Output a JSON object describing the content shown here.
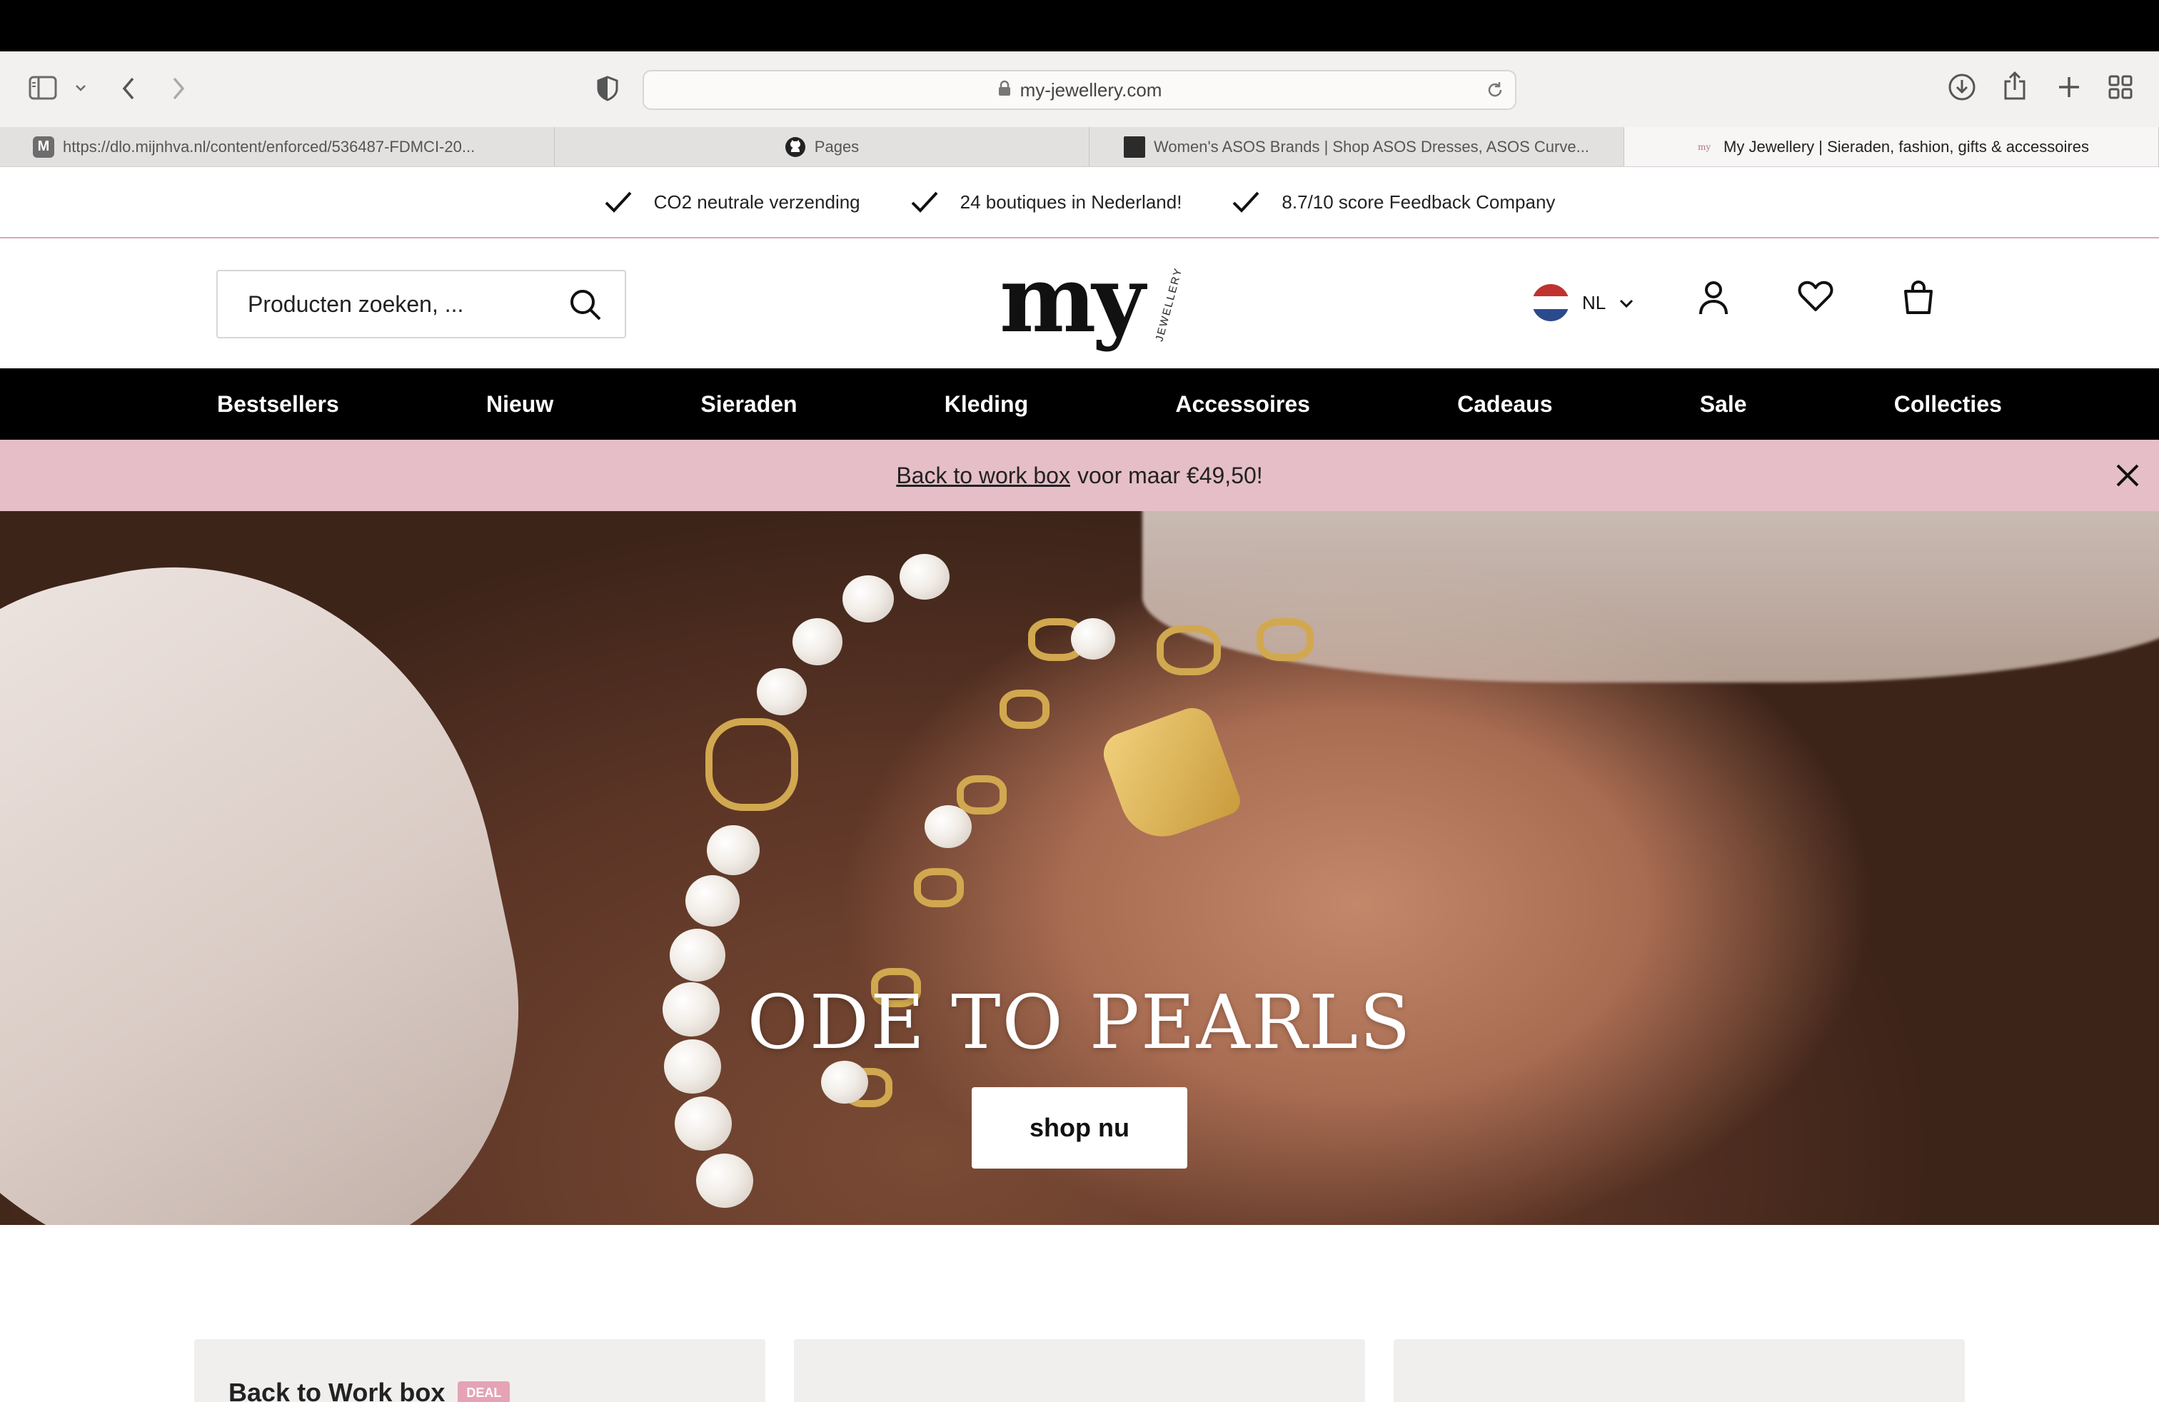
{
  "browser": {
    "url": "my-jewellery.com",
    "tabs": [
      {
        "label": "https://dlo.mijnhva.nl/content/enforced/536487-FDMCI-20...",
        "favicon": "M"
      },
      {
        "label": "Pages",
        "favicon": "github-icon"
      },
      {
        "label": "Women's ASOS Brands | Shop ASOS Dresses, ASOS Curve...",
        "favicon": "asos-icon"
      },
      {
        "label": "My Jewellery | Sieraden, fashion, gifts & accessoires",
        "favicon": "my"
      }
    ]
  },
  "usp": {
    "items": [
      "CO2 neutrale verzending",
      "24 boutiques in Nederland!",
      "8.7/10 score Feedback Company"
    ]
  },
  "header": {
    "search_placeholder": "Producten zoeken, ...",
    "logo_main": "my",
    "logo_sub": "JEWELLERY",
    "language": "NL"
  },
  "nav": {
    "items": [
      "Bestsellers",
      "Nieuw",
      "Sieraden",
      "Kleding",
      "Accessoires",
      "Cadeaus",
      "Sale",
      "Collecties"
    ]
  },
  "promo": {
    "link": "Back to work box",
    "text": "voor maar €49,50!"
  },
  "hero": {
    "title": "ODE TO PEARLS",
    "button": "shop nu"
  },
  "cards": {
    "first_title": "Back to Work box",
    "first_badge": "DEAL"
  },
  "colors": {
    "promo_bg": "#e5bec8",
    "nav_bg": "#000000",
    "accent_pink": "#d9a8b4"
  }
}
